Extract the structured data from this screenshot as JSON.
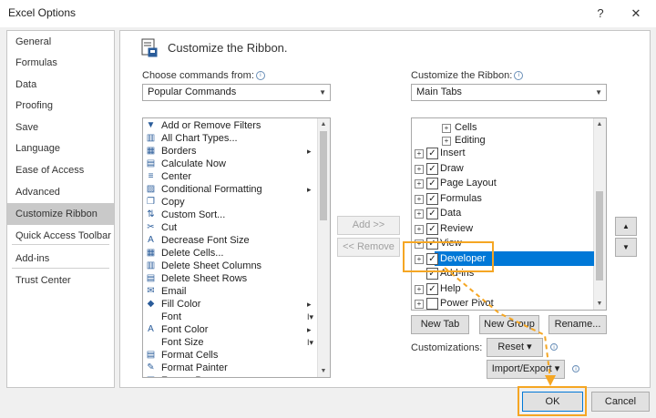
{
  "window": {
    "title": "Excel Options",
    "help_glyph": "?",
    "close_glyph": "✕"
  },
  "nav": {
    "items": [
      {
        "label": "General"
      },
      {
        "label": "Formulas"
      },
      {
        "label": "Data"
      },
      {
        "label": "Proofing"
      },
      {
        "label": "Save"
      },
      {
        "label": "Language"
      },
      {
        "label": "Ease of Access"
      },
      {
        "label": "Advanced"
      },
      {
        "label": "Customize Ribbon",
        "selected": true
      },
      {
        "label": "Quick Access Toolbar"
      },
      {
        "label": "Add-ins"
      },
      {
        "label": "Trust Center"
      }
    ]
  },
  "main": {
    "heading": "Customize the Ribbon.",
    "choose_label": "Choose commands from:",
    "choose_value": "Popular Commands",
    "customize_label": "Customize the Ribbon:",
    "customize_value": "Main Tabs",
    "info_glyph": "i",
    "commands": [
      {
        "icon": "add-remove-filters-icon",
        "glyph": "▼",
        "label": "Add or Remove Filters"
      },
      {
        "icon": "chart-types-icon",
        "glyph": "▥",
        "label": "All Chart Types..."
      },
      {
        "icon": "borders-icon",
        "glyph": "▦",
        "label": "Borders",
        "sub": "▸"
      },
      {
        "icon": "calculator-icon",
        "glyph": "▤",
        "label": "Calculate Now"
      },
      {
        "icon": "center-icon",
        "glyph": "≡",
        "label": "Center"
      },
      {
        "icon": "conditional-formatting-icon",
        "glyph": "▨",
        "label": "Conditional Formatting",
        "sub": "▸"
      },
      {
        "icon": "copy-icon",
        "glyph": "❐",
        "label": "Copy"
      },
      {
        "icon": "custom-sort-icon",
        "glyph": "⇅",
        "label": "Custom Sort..."
      },
      {
        "icon": "cut-icon",
        "glyph": "✂",
        "label": "Cut"
      },
      {
        "icon": "decrease-font-icon",
        "glyph": "A",
        "label": "Decrease Font Size"
      },
      {
        "icon": "delete-cells-icon",
        "glyph": "▦",
        "label": "Delete Cells..."
      },
      {
        "icon": "delete-columns-icon",
        "glyph": "▥",
        "label": "Delete Sheet Columns"
      },
      {
        "icon": "delete-rows-icon",
        "glyph": "▤",
        "label": "Delete Sheet Rows"
      },
      {
        "icon": "email-icon",
        "glyph": "✉",
        "label": "Email"
      },
      {
        "icon": "fill-color-icon",
        "glyph": "◆",
        "label": "Fill Color",
        "sub": "▸"
      },
      {
        "icon": "font-icon",
        "glyph": "",
        "label": "Font",
        "sub": "I▾"
      },
      {
        "icon": "font-color-icon",
        "glyph": "A",
        "label": "Font Color",
        "sub": "▸"
      },
      {
        "icon": "font-size-icon",
        "glyph": "",
        "label": "Font Size",
        "sub": "I▾"
      },
      {
        "icon": "format-cells-icon",
        "glyph": "▤",
        "label": "Format Cells"
      },
      {
        "icon": "format-painter-icon",
        "glyph": "✎",
        "label": "Format Painter"
      },
      {
        "icon": "freeze-panes-icon",
        "glyph": "▦",
        "label": "Freeze Panes",
        "sub": "▸"
      }
    ],
    "add_button": "Add >>",
    "remove_button": "<< Remove",
    "tree": [
      {
        "level": 2,
        "expander": "+",
        "checkbox": false,
        "label": "Cells"
      },
      {
        "level": 2,
        "expander": "+",
        "checkbox": false,
        "label": "Editing"
      },
      {
        "level": 1,
        "expander": "+",
        "checkbox": true,
        "checked": true,
        "label": "Insert"
      },
      {
        "level": 1,
        "expander": "+",
        "checkbox": true,
        "checked": true,
        "label": "Draw"
      },
      {
        "level": 1,
        "expander": "+",
        "checkbox": true,
        "checked": true,
        "label": "Page Layout"
      },
      {
        "level": 1,
        "expander": "+",
        "checkbox": true,
        "checked": true,
        "label": "Formulas"
      },
      {
        "level": 1,
        "expander": "+",
        "checkbox": true,
        "checked": true,
        "label": "Data"
      },
      {
        "level": 1,
        "expander": "+",
        "checkbox": true,
        "checked": true,
        "label": "Review"
      },
      {
        "level": 1,
        "expander": "+",
        "checkbox": true,
        "checked": true,
        "label": "View"
      },
      {
        "level": 1,
        "expander": "+",
        "checkbox": true,
        "checked": true,
        "label": "Developer",
        "selected": true
      },
      {
        "level": 1,
        "expander": "",
        "checkbox": true,
        "checked": true,
        "label": "Add-ins"
      },
      {
        "level": 1,
        "expander": "+",
        "checkbox": true,
        "checked": true,
        "label": "Help"
      },
      {
        "level": 1,
        "expander": "+",
        "checkbox": true,
        "checked": false,
        "label": "Power Pivot"
      }
    ],
    "move_up_glyph": "▲",
    "move_down_glyph": "▼",
    "new_tab_button": "New Tab",
    "new_group_button": "New Group",
    "rename_button": "Rename...",
    "customizations_label": "Customizations:",
    "reset_button": "Reset",
    "import_export_button": "Import/Export",
    "dropdown_glyph": "▾"
  },
  "footer": {
    "ok_button": "OK",
    "cancel_button": "Cancel"
  },
  "colors": {
    "highlight": "#f5a623",
    "selection": "#0078d7"
  }
}
